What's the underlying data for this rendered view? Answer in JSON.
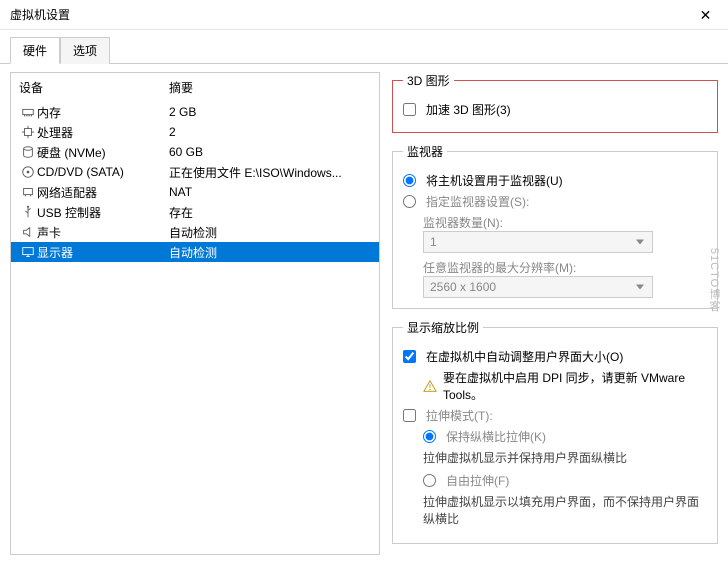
{
  "window": {
    "title": "虚拟机设置",
    "close": "✕"
  },
  "tabs": {
    "hardware": "硬件",
    "options": "选项"
  },
  "hw_header": {
    "device": "设备",
    "summary": "摘要"
  },
  "hw": [
    {
      "icon": "memory-icon",
      "name": "内存",
      "summary": "2 GB"
    },
    {
      "icon": "cpu-icon",
      "name": "处理器",
      "summary": "2"
    },
    {
      "icon": "disk-icon",
      "name": "硬盘 (NVMe)",
      "summary": "60 GB"
    },
    {
      "icon": "cd-icon",
      "name": "CD/DVD (SATA)",
      "summary": "正在使用文件 E:\\ISO\\Windows..."
    },
    {
      "icon": "nic-icon",
      "name": "网络适配器",
      "summary": "NAT"
    },
    {
      "icon": "usb-icon",
      "name": "USB 控制器",
      "summary": "存在"
    },
    {
      "icon": "sound-icon",
      "name": "声卡",
      "summary": "自动检测"
    },
    {
      "icon": "display-icon",
      "name": "显示器",
      "summary": "自动检测"
    }
  ],
  "graphics3d": {
    "legend": "3D 图形",
    "accelerate": "加速 3D 图形(3)"
  },
  "monitors": {
    "legend": "监视器",
    "use_host": "将主机设置用于监视器(U)",
    "specify": "指定监视器设置(S):",
    "count_label": "监视器数量(N):",
    "count_value": "1",
    "maxres_label": "任意监视器的最大分辨率(M):",
    "maxres_value": "2560 x 1600"
  },
  "scaling": {
    "legend": "显示缩放比例",
    "auto_resize": "在虚拟机中自动调整用户界面大小(O)",
    "dpi_warning": "要在虚拟机中启用 DPI 同步，请更新 VMware Tools。",
    "stretch_mode": "拉伸模式(T):",
    "keep_aspect": "保持纵横比拉伸(K)",
    "keep_aspect_desc": "拉伸虚拟机显示并保持用户界面纵横比",
    "free_stretch": "自由拉伸(F)",
    "free_stretch_desc": "拉伸虚拟机显示以填充用户界面，而不保持用户界面纵横比"
  },
  "watermark": "51CTO博客"
}
